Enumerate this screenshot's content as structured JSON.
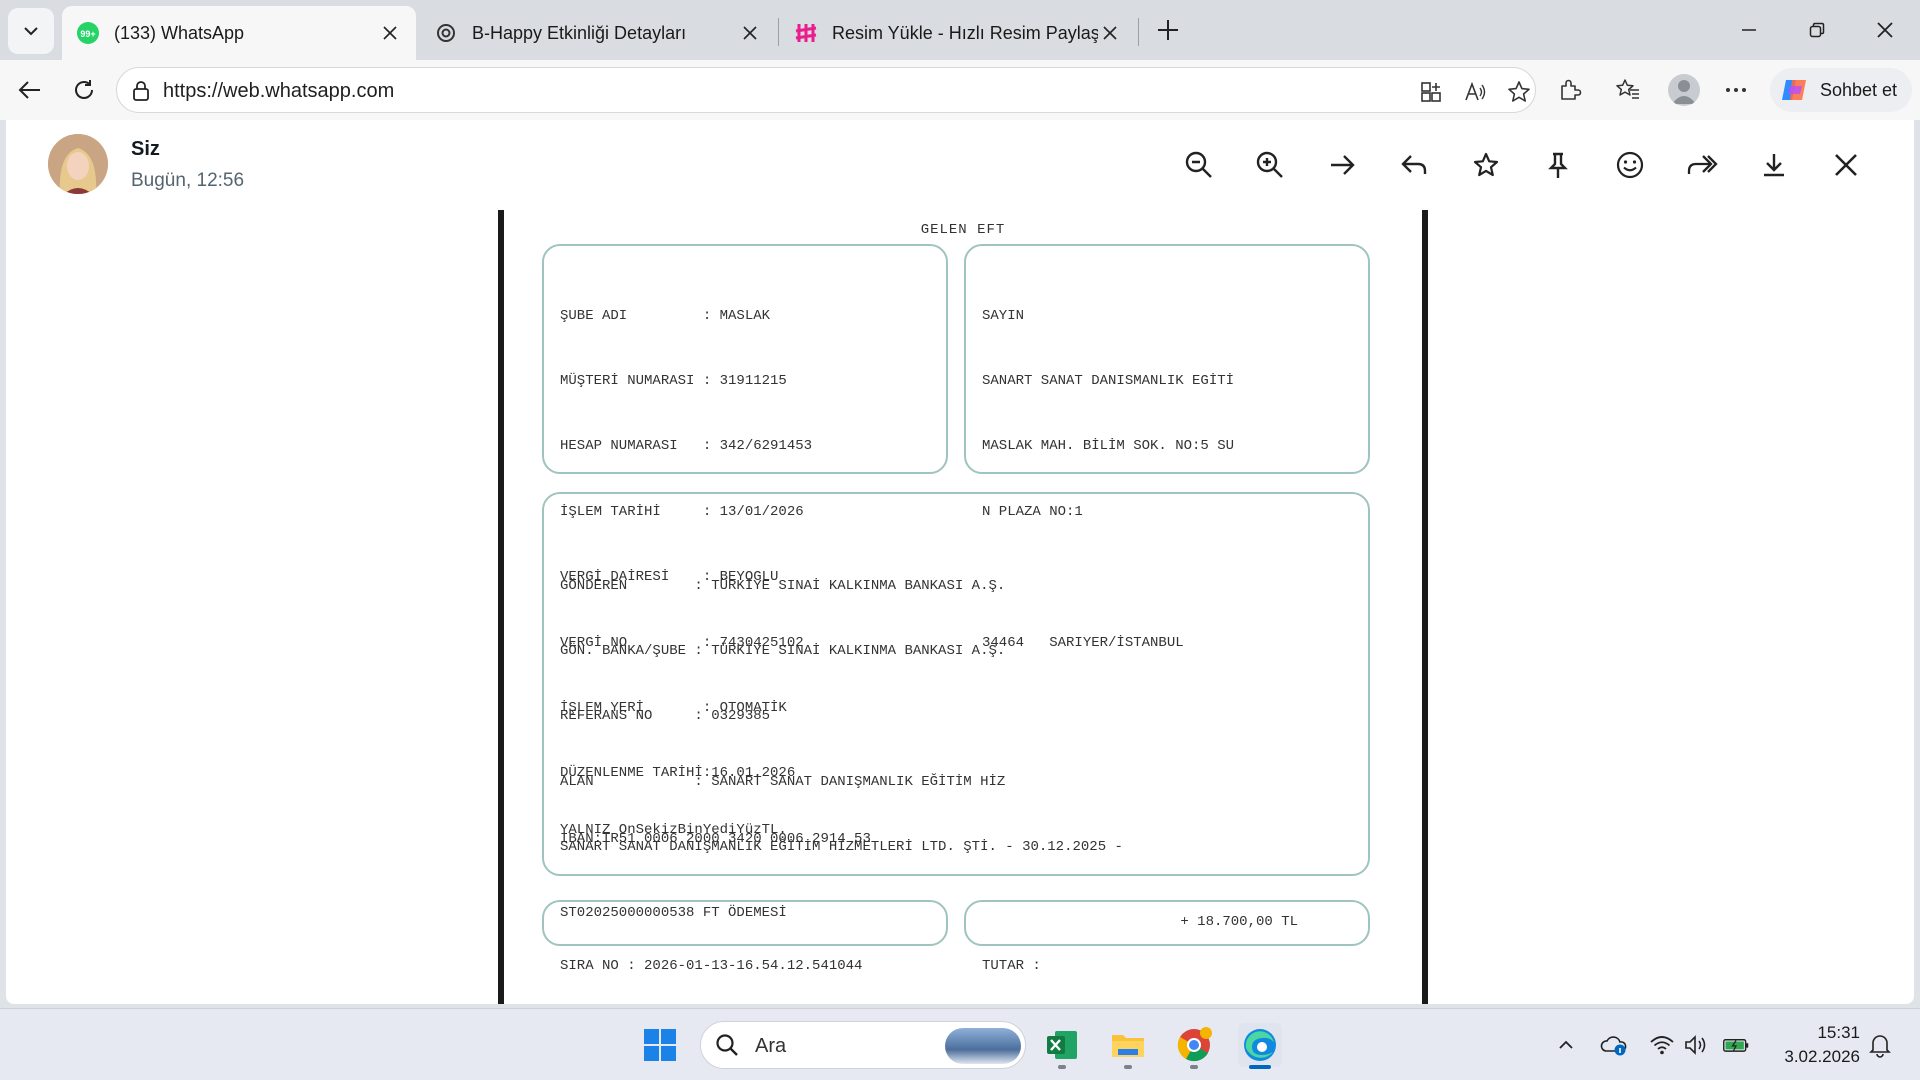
{
  "browser": {
    "tabs": [
      {
        "title": "(133) WhatsApp",
        "badge": "99+"
      },
      {
        "title": "B-Happy Etkinliği Detayları"
      },
      {
        "title": "Resim Yükle - Hızlı Resim Paylaş - R"
      }
    ],
    "url": "https://web.whatsapp.com",
    "copilot_label": "Sohbet et"
  },
  "viewer": {
    "sender": "Siz",
    "timestamp": "Bugün, 12:56"
  },
  "document": {
    "title": "GELEN EFT",
    "account_box": [
      "ŞUBE ADI         : MASLAK",
      "MÜŞTERİ NUMARASI : 31911215",
      "HESAP NUMARASI   : 342/6291453",
      "İŞLEM TARİHİ     : 13/01/2026",
      "VERGİ DAİRESİ    : BEYOGLU",
      "VERGİ NO         : 7430425102",
      "İŞLEM YERİ       : OTOMATİK",
      "DÜZENLENME TARİHİ:16.01.2026",
      "IBAN:TR51 0006 2000 3420 0006 2914 53"
    ],
    "address_box": [
      "SAYIN",
      "SANART SANAT DANISMANLIK EGİTİ",
      "MASLAK MAH. BİLİM SOK. NO:5 SU",
      "N PLAZA NO:1",
      "",
      "34464   SARIYER/İSTANBUL"
    ],
    "transfer_box": [
      "GÖNDEREN        : TÜRKİYE SINAİ KALKINMA BANKASI A.Ş.",
      "GÖN. BANKA/ŞUBE : TÜRKİYE SINAİ KALKINMA BANKASI A.Ş.",
      "REFERANS NO     : 0329385",
      "ALAN            : SANART SANAT DANIŞMANLIK EĞİTİM HİZ",
      "SANART SANAT DANIŞMANLIK EĞİTİM HİZMETLERİ LTD. ŞTİ. - 30.12.2025 -",
      "ST02025000000538 FT ÖDEMESİ"
    ],
    "amount_words": "YALNIZ OnSekizBinYediYüzTL.",
    "sira_no": "SIRA NO : 2026-01-13-16.54.12.541044",
    "tutar_label": "TUTAR :",
    "tutar_value": "+ 18.700,00 TL"
  },
  "taskbar": {
    "search_placeholder": "Ara",
    "time": "15:31",
    "date": "3.02.2026"
  }
}
